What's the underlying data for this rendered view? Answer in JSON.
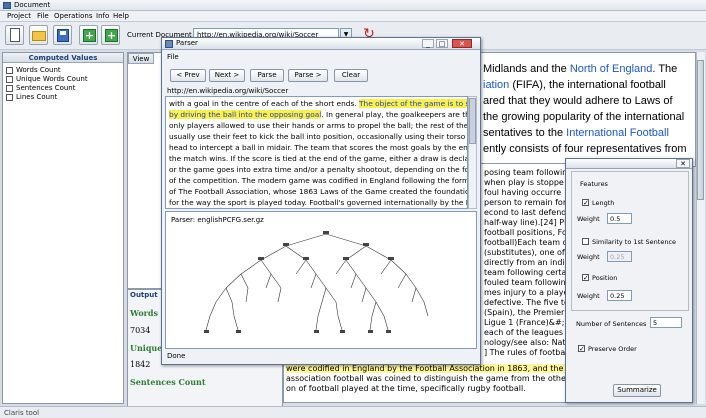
{
  "window": {
    "title": "Document"
  },
  "menu": [
    "Project",
    "File",
    "Operations",
    "Info",
    "Help"
  ],
  "toolbar": {
    "current_document_label": "Current Document",
    "current_document_value": "http://en.wikipedia.org/wiki/Soccer"
  },
  "left_panel": {
    "title": "Computed Values",
    "items": [
      "Words Count",
      "Unique Words Count",
      "Sentences Count",
      "Lines Count"
    ]
  },
  "view_panel": {
    "tab": "View"
  },
  "output_panel": {
    "title": "Output",
    "lines": [
      "Words Count",
      "7034",
      "Unique Words",
      "1842",
      "Sentences Count"
    ]
  },
  "document_text": {
    "line1_a": "Midlands and the ",
    "line1_b": "North of England",
    "line1_c": ". The",
    "line2_a": "iation",
    "line2_b": " (FIFA), the international football",
    "line3": "ared that they would adhere to Laws of",
    "line4": "the growing popularity of the international",
    "line5_a": "sentatives to the ",
    "line5_b": "International Football",
    "line6": "ently consists of four representatives from"
  },
  "lower_text": [
    "posing team following",
    "when play is stoppe",
    "foul having occurre",
    "person to remain forward (in",
    "econd to last defende",
    "half-way line).[24] Pla",
    "football positions, Forma",
    "football)Each team c",
    "(substitutes), one of whic",
    "directly from an indir",
    "team following certain",
    "fouled team following",
    "mes injury to a player",
    "defective. The five to",
    "(Spain), the Premier",
    "Ligue 1 (France)&#;",
    "each of the leagues h",
    "nology/see also: Nat",
    "] The rules of football",
    "were codified in England by the Football Association in 1863, and the name",
    "association football was coined to distinguish the game from the other fo",
    "on of football played at the time, specifically rugby football."
  ],
  "parser": {
    "title": "Parser",
    "menu": "File",
    "buttons": [
      "< Prev",
      "Next >",
      "Parse",
      "Parse >",
      "Clear"
    ],
    "url": "http://en.wikipedia.org/wiki/Soccer",
    "text_lines": [
      "with a goal in the centre of each of the short ends. ",
      "by driving the ball into the opposing goal",
      "only players allowed to use their hands or arms to propel the ball; the rest of the team",
      "usually use their feet to kick the ball into position, occasionally using their torso or",
      "head to intercept a ball in midair. The team that scores the most goals by the end of",
      "the match wins. If the score is tied at the end of the game, either a draw is declared",
      "or the game goes into extra time and/or a penalty shootout, depending on the format",
      "of the competition. The modern game was codified in England following the formation",
      "of The Football Association, whose 1863 Laws of the Game created the foundations",
      "for the way the sport is played today. Football's governed internationally by the FA"
    ],
    "highlight_1": "The object of the game is to score",
    "line2_tail": ". In general play, the goalkeepers are the",
    "info": "Parser: englishPCFG.ser.gz",
    "status": "Done"
  },
  "summary": {
    "features_label": "Features",
    "length_label": "Length",
    "length_checked": true,
    "weight_label": "Weight",
    "length_weight": "0.5",
    "similarity_label": "Similarity to 1st Sentence",
    "similarity_checked": false,
    "similarity_weight": "0.25",
    "position_label": "Position",
    "position_checked": true,
    "position_weight": "0.25",
    "num_sentences_label": "Number of Sentences",
    "num_sentences_value": "5",
    "preserve_order_label": "Preserve Order",
    "preserve_order_checked": true,
    "summarize_button": "Summarize"
  },
  "statusbar": {
    "text": "Claris tool"
  }
}
